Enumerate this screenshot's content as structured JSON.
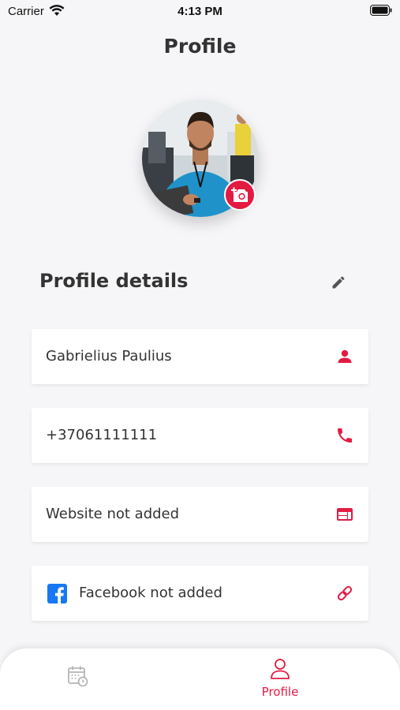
{
  "status_bar": {
    "carrier": "Carrier",
    "time": "4:13 PM"
  },
  "header": {
    "title": "Profile"
  },
  "profile": {
    "section_title": "Profile details",
    "name": "Gabrielius Paulius",
    "phone": "+37061111111",
    "website": "Website not added",
    "facebook": "Facebook not added"
  },
  "bottom_nav": {
    "items": [
      {
        "icon": "calendar-clock-icon",
        "label": ""
      },
      {
        "icon": "person-outline-icon",
        "label": "Profile"
      }
    ]
  },
  "colors": {
    "accent": "#e31b43",
    "background": "#f6f6f8",
    "facebook": "#1877f2"
  }
}
